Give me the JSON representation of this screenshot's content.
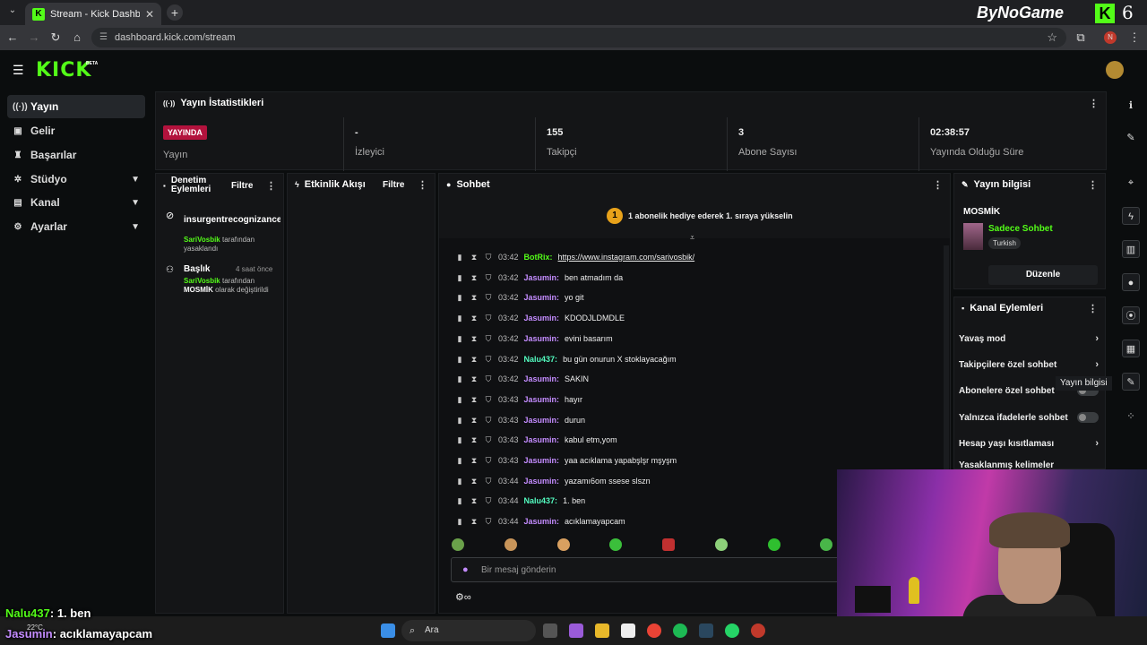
{
  "browser": {
    "tab_title": "Stream - Kick Dashboard",
    "url": "dashboard.kick.com/stream",
    "overlay_brand": "ByNoGame",
    "overlay_brand_k": "K",
    "overlay_brand_6": "6"
  },
  "app": {
    "logo": "KICK",
    "beta": "BETA"
  },
  "sidebar": {
    "items": [
      {
        "label": "Yayın",
        "icon": "broadcast-icon",
        "active": true
      },
      {
        "label": "Gelir",
        "icon": "revenue-icon"
      },
      {
        "label": "Başarılar",
        "icon": "trophy-icon"
      },
      {
        "label": "Stüdyo",
        "icon": "studio-icon",
        "expandable": true
      },
      {
        "label": "Kanal",
        "icon": "channel-icon",
        "expandable": true
      },
      {
        "label": "Ayarlar",
        "icon": "settings-icon",
        "expandable": true
      }
    ]
  },
  "stats": {
    "title": "Yayın İstatistikleri",
    "live_badge": "YAYINDA",
    "live_label": "Yayın",
    "items": [
      {
        "value": "-",
        "label": "İzleyici"
      },
      {
        "value": "155",
        "label": "Takipçi"
      },
      {
        "value": "3",
        "label": "Abone Sayısı"
      },
      {
        "value": "02:38:57",
        "label": "Yayında Olduğu Süre"
      }
    ]
  },
  "moderation": {
    "title": "Denetim Eylemleri",
    "filter": "Filtre",
    "entries": [
      {
        "user": "insurgentrecognizance",
        "by": "SariVosbik",
        "action": "tarafından yasaklandı"
      },
      {
        "title": "Başlık",
        "time": "4 saat önce",
        "by": "SariVosbik",
        "action_1": "tarafından",
        "target": "MOSMİK",
        "action_2": "olarak değiştirildi"
      }
    ]
  },
  "activity": {
    "title": "Etkinlik Akışı",
    "filter": "Filtre"
  },
  "chat": {
    "title": "Sohbet",
    "goal_rank": "1",
    "goal_text": "1 abonelik hediye ederek 1. sıraya yükselin",
    "placeholder": "Bir mesaj gönderin",
    "messages": [
      {
        "time": "03:42",
        "user": "BotRix",
        "color": "#53fc18",
        "text": "https://www.instagram.com/sarivosbik/",
        "link": true
      },
      {
        "time": "03:42",
        "user": "Jasumin",
        "color": "#c48cff",
        "text": "ben atmadım da"
      },
      {
        "time": "03:42",
        "user": "Jasumin",
        "color": "#c48cff",
        "text": "yo git"
      },
      {
        "time": "03:42",
        "user": "Jasumin",
        "color": "#c48cff",
        "text": "KDODJLDMDLE"
      },
      {
        "time": "03:42",
        "user": "Jasumin",
        "color": "#c48cff",
        "text": "evini basarım"
      },
      {
        "time": "03:42",
        "user": "Nalu437",
        "color": "#53fcc0",
        "text": "bu gün onurun X stoklayacağım"
      },
      {
        "time": "03:42",
        "user": "Jasumin",
        "color": "#c48cff",
        "text": "SAKIN"
      },
      {
        "time": "03:43",
        "user": "Jasumin",
        "color": "#c48cff",
        "text": "hayır"
      },
      {
        "time": "03:43",
        "user": "Jasumin",
        "color": "#c48cff",
        "text": "durun"
      },
      {
        "time": "03:43",
        "user": "Jasumin",
        "color": "#c48cff",
        "text": "kabul etm,yom"
      },
      {
        "time": "03:43",
        "user": "Jasumin",
        "color": "#c48cff",
        "text": "yaa acıklama yapabşlşr mşyşm"
      },
      {
        "time": "03:44",
        "user": "Jasumin",
        "color": "#c48cff",
        "text": "yazamı6om ssese slszn"
      },
      {
        "time": "03:44",
        "user": "Nalu437",
        "color": "#53fcc0",
        "text": "1. ben"
      },
      {
        "time": "03:44",
        "user": "Jasumin",
        "color": "#c48cff",
        "text": "acıklamayapcam"
      }
    ]
  },
  "stream_info": {
    "title": "Yayın bilgisi",
    "stream_title": "MOSMİK",
    "category": "Sadece Sohbet",
    "language": "Turkish",
    "edit": "Düzenle"
  },
  "channel_actions": {
    "title": "Kanal Eylemleri",
    "items": [
      {
        "label": "Yavaş mod",
        "type": "arrow"
      },
      {
        "label": "Takipçilere özel sohbet",
        "type": "arrow"
      },
      {
        "label": "Abonelere özel sohbet",
        "type": "toggle"
      },
      {
        "label": "Yalnızca ifadelerle sohbet",
        "type": "toggle"
      },
      {
        "label": "Hesap yaşı kısıtlaması",
        "type": "arrow"
      },
      {
        "label": "Yasaklanmış kelimeler",
        "type": "arrow"
      }
    ]
  },
  "tooltip": "Yayın bilgisi",
  "taskbar": {
    "search": "Ara",
    "weather": "22°C"
  },
  "overlay_chat": [
    {
      "user": "Nalu437",
      "text": ": 1. ben"
    },
    {
      "user": "Jasumin",
      "text": ": acıklamayapcam"
    }
  ]
}
